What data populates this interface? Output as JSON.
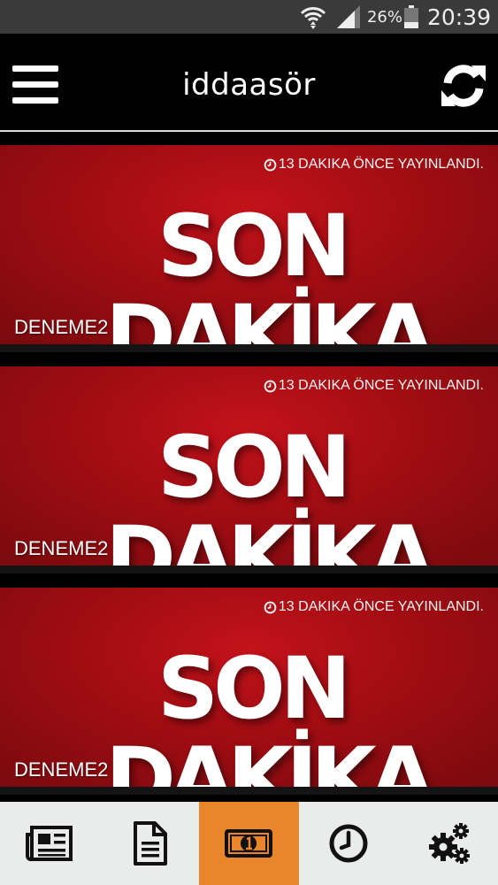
{
  "status_bar": {
    "battery_percent": "26%",
    "time": "20:39"
  },
  "header": {
    "title": "iddaasör",
    "menu_icon": "hamburger-menu-icon",
    "refresh_icon": "refresh-icon"
  },
  "news": [
    {
      "timestamp": "13 DAKIKA ÖNCE YAYINLANDI.",
      "image_line1": "SON",
      "image_line2": "DAKİKA",
      "title": "DENEME2"
    },
    {
      "timestamp": "13 DAKIKA ÖNCE YAYINLANDI.",
      "image_line1": "SON",
      "image_line2": "DAKİKA",
      "title": "DENEME2"
    },
    {
      "timestamp": "13 DAKIKA ÖNCE YAYINLANDI.",
      "image_line1": "SON",
      "image_line2": "DAKİKA",
      "title": "DENEME2"
    }
  ],
  "bottom_nav": {
    "active_index": 2,
    "items": [
      {
        "icon": "newspaper-icon"
      },
      {
        "icon": "document-icon"
      },
      {
        "icon": "money-bill-icon"
      },
      {
        "icon": "clock-icon"
      },
      {
        "icon": "gears-icon"
      }
    ]
  },
  "colors": {
    "accent_active_tab": "#e9852a",
    "card_red": "#b50f16",
    "nav_background": "#e9eceb"
  }
}
